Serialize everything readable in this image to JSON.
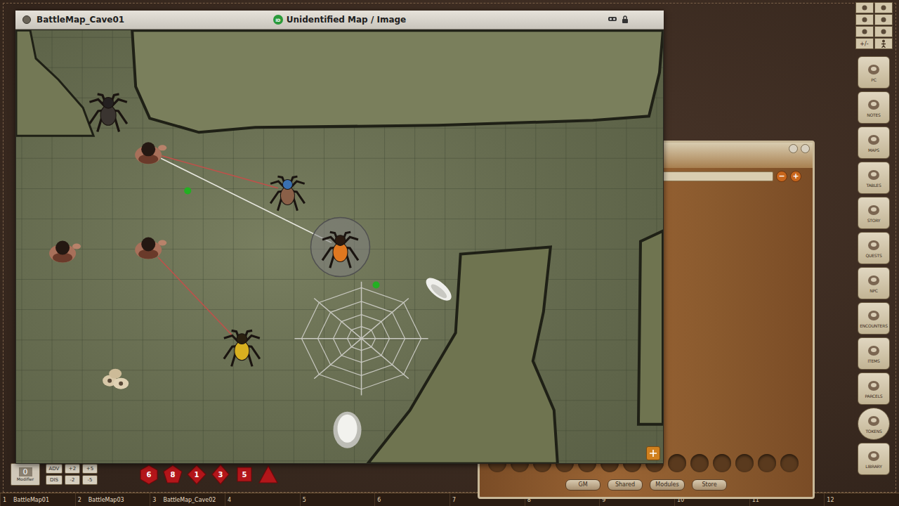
{
  "map_window": {
    "title": "BattleMap_Cave01",
    "id_badge": "ID",
    "subtitle": "Unidentified Map / Image"
  },
  "map": {
    "tokens": [
      {
        "kind": "spider",
        "selected": false
      },
      {
        "kind": "human",
        "selected": false
      },
      {
        "kind": "spider",
        "selected": false
      },
      {
        "kind": "spider",
        "selected": true
      },
      {
        "kind": "human",
        "selected": false
      },
      {
        "kind": "human",
        "selected": false
      },
      {
        "kind": "spider",
        "selected": false
      },
      {
        "kind": "bones",
        "selected": false
      },
      {
        "kind": "web",
        "selected": false
      },
      {
        "kind": "fur",
        "selected": false
      },
      {
        "kind": "egg",
        "selected": false
      },
      {
        "kind": "marker",
        "selected": false
      },
      {
        "kind": "marker",
        "selected": false
      }
    ],
    "targets": [
      {
        "from": 1,
        "to": 2,
        "color": "#c0504a"
      },
      {
        "from": 1,
        "to": 3,
        "color": "#e8e8e0"
      },
      {
        "from": 5,
        "to": 6,
        "color": "#c0504a"
      }
    ]
  },
  "toolbar": {
    "zoom_label": "+/-"
  },
  "sidebar": {
    "items": [
      "PC",
      "NOTES",
      "MAPS",
      "TABLES",
      "STORY",
      "QUESTS",
      "NPC",
      "ENCOUNTERS",
      "ITEMS",
      "PARCELS",
      "TOKENS",
      "LIBRARY"
    ]
  },
  "token_panel": {
    "search": {
      "placeholder": ""
    },
    "zoom_buttons": [
      "−",
      "+"
    ],
    "tabs": [
      {
        "label": "GM",
        "selected": false
      },
      {
        "label": "Shared",
        "selected": false
      },
      {
        "label": "Modules",
        "selected": false
      },
      {
        "label": "Store",
        "selected": false
      }
    ]
  },
  "dice_tray": {
    "modifier": {
      "value": "0",
      "label": "Modifier"
    },
    "adv": "ADV",
    "dis": "DIS",
    "bonuses": [
      "+2",
      "+5",
      "-2",
      "-5"
    ],
    "dice": [
      {
        "kind": "d20",
        "label": "6"
      },
      {
        "kind": "d12",
        "label": "8"
      },
      {
        "kind": "d10",
        "label": "1"
      },
      {
        "kind": "d8",
        "label": "3"
      },
      {
        "kind": "d6",
        "label": "5"
      },
      {
        "kind": "d4",
        "label": ""
      }
    ]
  },
  "hotkeys": [
    {
      "number": "1",
      "label": "BattleMap01"
    },
    {
      "number": "2",
      "label": "BattleMap03"
    },
    {
      "number": "3",
      "label": "BattleMap_Cave02"
    },
    {
      "number": "4",
      "label": ""
    },
    {
      "number": "5",
      "label": ""
    },
    {
      "number": "6",
      "label": ""
    },
    {
      "number": "7",
      "label": ""
    },
    {
      "number": "8",
      "label": ""
    },
    {
      "number": "9",
      "label": ""
    },
    {
      "number": "10",
      "label": ""
    },
    {
      "number": "11",
      "label": ""
    },
    {
      "number": "12",
      "label": ""
    }
  ]
}
